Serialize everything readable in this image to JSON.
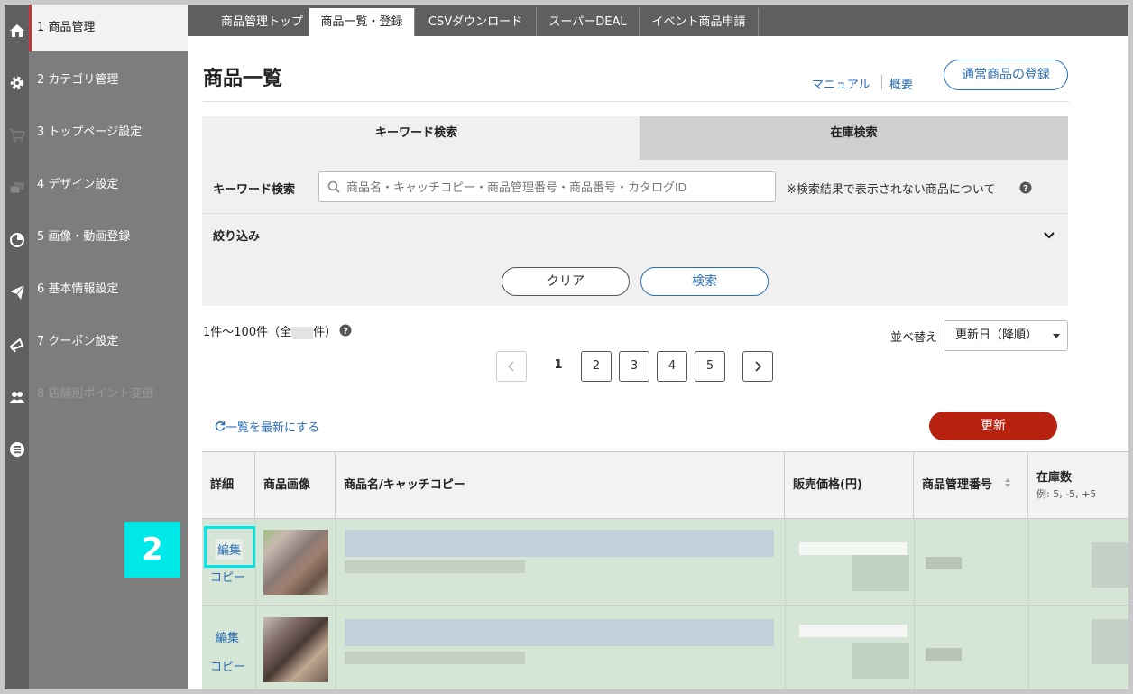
{
  "sidebar": {
    "items": [
      {
        "label": "1 商品管理",
        "icon": "home-icon"
      },
      {
        "label": "2 カテゴリ管理",
        "icon": "gear-icon"
      },
      {
        "label": "3 トップページ設定",
        "icon": "cart-icon"
      },
      {
        "label": "4 デザイン設定",
        "icon": "windows-icon"
      },
      {
        "label": "5 画像・動画登録",
        "icon": "pie-chart-icon"
      },
      {
        "label": "6 基本情報設定",
        "icon": "paper-plane-icon"
      },
      {
        "label": "7 クーポン設定",
        "icon": "megaphone-icon"
      },
      {
        "label": "8 店舗別ポイント変倍",
        "icon": "users-icon"
      },
      {
        "label": "",
        "icon": "list-icon"
      }
    ]
  },
  "top_tabs": [
    "商品管理トップ",
    "商品一覧・登録",
    "CSVダウンロード",
    "スーパーDEAL",
    "イベント商品申請"
  ],
  "header": {
    "title": "商品一覧",
    "manual_link": "マニュアル",
    "overview_link": "概要",
    "register_button": "通常商品の登録"
  },
  "search": {
    "tab_keyword": "キーワード検索",
    "tab_stock": "在庫検索",
    "keyword_label": "キーワード検索",
    "placeholder": "商品名・キャッチコピー・商品管理番号・商品番号・カタログID",
    "note": "※検索結果で表示されない商品について",
    "filter_label": "絞り込み",
    "clear_button": "クリア",
    "search_button": "検索"
  },
  "results": {
    "count_prefix": "1件〜100件（全",
    "count_suffix": "件）",
    "sort_label": "並べ替え",
    "sort_value": "更新日（降順）",
    "pages": [
      "1",
      "2",
      "3",
      "4",
      "5"
    ],
    "current_page": "1",
    "refresh_link": "一覧を最新にする",
    "update_button": "更新"
  },
  "table": {
    "headers": {
      "detail": "詳細",
      "image": "商品画像",
      "name": "商品名/キャッチコピー",
      "price": "販売価格(円)",
      "code": "商品管理番号",
      "stock": "在庫数",
      "stock_hint": "例: 5, -5, +5"
    },
    "rows": [
      {
        "edit": "編集",
        "copy": "コピー"
      },
      {
        "edit": "編集",
        "copy": "コピー"
      }
    ]
  },
  "annotation": {
    "step_number": "2"
  },
  "colors": {
    "accent_blue": "#2a6cb5",
    "update_red": "#b8200f",
    "highlight_cyan": "#00e8e8",
    "sidebar_active_border": "#c8353a"
  }
}
